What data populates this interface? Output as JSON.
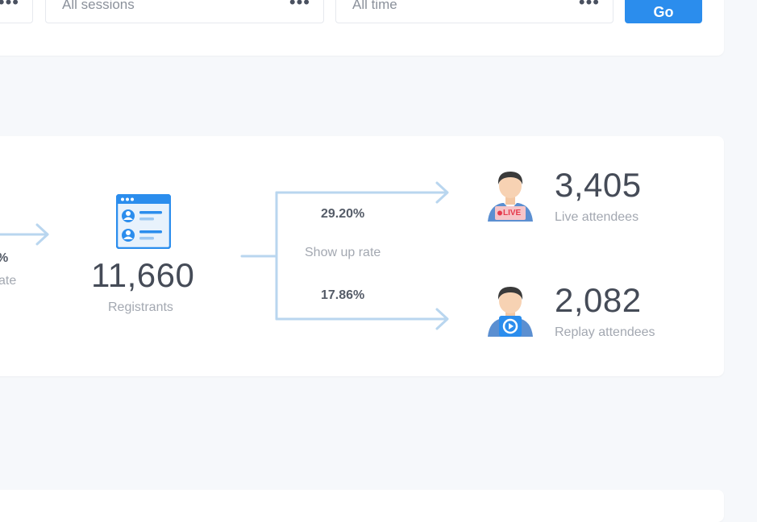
{
  "filters": {
    "session_select": "All sessions",
    "time_select": "All time",
    "go_label": "Go"
  },
  "funnel": {
    "left_pct_partial": "%",
    "left_label_partial": "ate",
    "registrants_value": "11,660",
    "registrants_label": "Registrants",
    "show_up_rate_label": "Show up rate",
    "live_pct": "29.20%",
    "replay_pct": "17.86%",
    "live_value": "3,405",
    "live_label": "Live attendees",
    "live_badge": "LIVE",
    "replay_value": "2,082",
    "replay_label": "Replay attendees"
  },
  "colors": {
    "accent": "#2b8ded",
    "arrow": "#b9d6ef",
    "live_badge": "#e63b4d"
  }
}
